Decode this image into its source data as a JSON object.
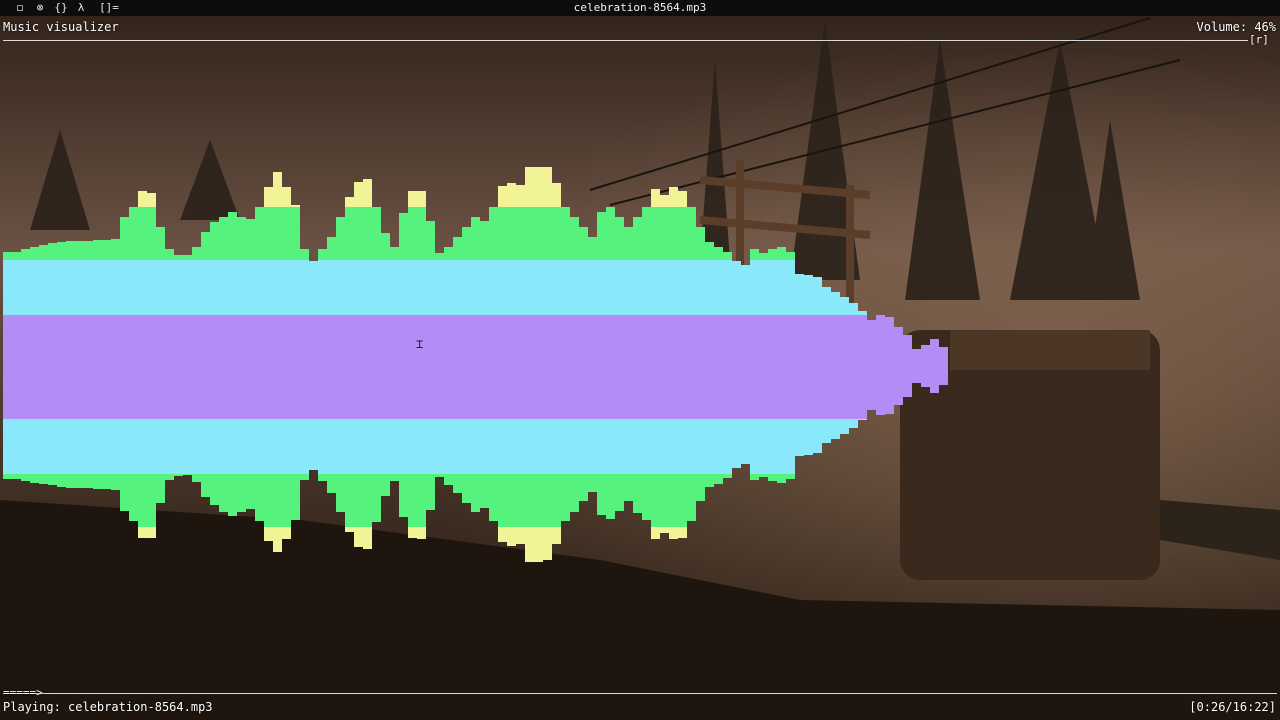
{
  "topbar": {
    "workspaces": [
      "◻",
      "⊗",
      "{}",
      "λ",
      "[]="
    ],
    "window_title": "celebration-8564.mp3"
  },
  "player": {
    "screen_title": "Music visualizer",
    "volume": "Volume: 46%",
    "mode_indicators": "[r]",
    "progress_bar_text": "=====>",
    "status_text": "Playing: celebration-8564.mp3",
    "elapsed_total": "[0:26/16:22]"
  },
  "visualizer": {
    "colors": {
      "pink": "#f48ce4",
      "yellow": "#f2f296",
      "green": "#56f27e",
      "cyan": "#8ae8fb",
      "purple": "#b48cf6"
    },
    "column_heights_top": [
      115,
      115,
      118,
      120,
      122,
      124,
      125,
      126,
      126,
      126,
      127,
      127,
      128,
      150,
      160,
      176,
      174,
      140,
      118,
      112,
      112,
      120,
      135,
      145,
      150,
      155,
      150,
      148,
      160,
      180,
      195,
      180,
      162,
      118,
      106,
      118,
      130,
      150,
      170,
      185,
      188,
      160,
      134,
      120,
      154,
      176,
      176,
      146,
      114,
      120,
      130,
      140,
      150,
      146,
      160,
      181,
      184,
      182,
      200,
      200,
      200,
      184,
      160,
      150,
      140,
      130,
      155,
      160,
      150,
      140,
      150,
      160,
      178,
      172,
      180,
      176,
      160,
      140,
      125,
      120,
      115,
      106,
      102,
      118,
      114,
      118,
      120,
      115,
      93,
      92,
      90,
      80,
      75,
      70,
      64,
      56,
      47,
      52,
      50,
      40,
      32,
      18,
      22,
      28,
      20
    ],
    "column_heights_bottom": [
      112,
      112,
      114,
      116,
      117,
      118,
      120,
      121,
      121,
      121,
      122,
      122,
      123,
      144,
      154,
      171,
      171,
      136,
      113,
      109,
      108,
      115,
      130,
      138,
      145,
      149,
      145,
      142,
      154,
      174,
      185,
      172,
      153,
      113,
      103,
      114,
      126,
      145,
      165,
      180,
      182,
      155,
      129,
      114,
      150,
      171,
      172,
      143,
      110,
      118,
      126,
      136,
      145,
      141,
      154,
      175,
      179,
      177,
      195,
      195,
      193,
      177,
      154,
      145,
      134,
      125,
      148,
      152,
      144,
      134,
      146,
      153,
      172,
      166,
      172,
      171,
      154,
      134,
      120,
      117,
      111,
      101,
      97,
      113,
      110,
      114,
      116,
      112,
      89,
      88,
      86,
      76,
      72,
      67,
      61,
      53,
      43,
      48,
      47,
      38,
      30,
      16,
      20,
      26,
      18
    ]
  }
}
